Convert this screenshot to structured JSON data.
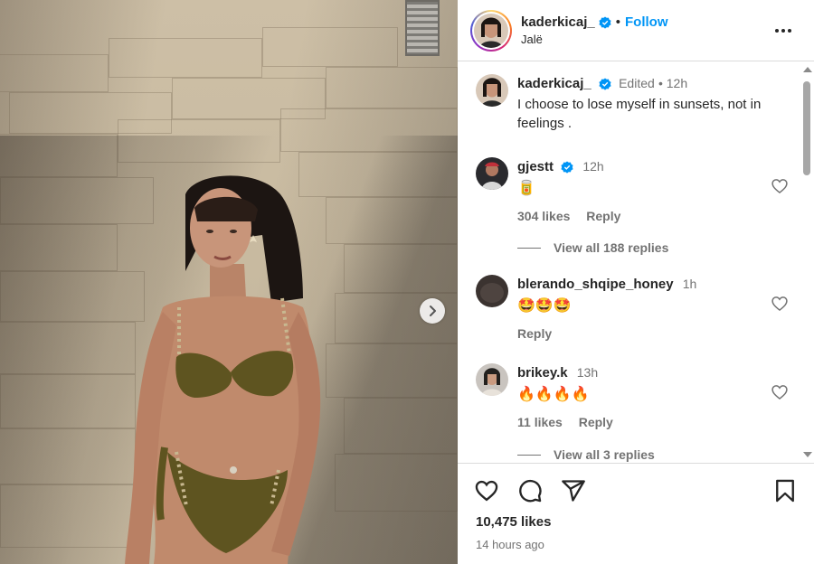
{
  "post": {
    "author": "kaderkicaj_",
    "follow_label": "Follow",
    "location": "Jalë",
    "likes": "10,475 likes",
    "time_ago": "14 hours ago"
  },
  "caption": {
    "username": "kaderkicaj_",
    "edited": "Edited",
    "time": "12h",
    "text": "I choose to lose myself in sunsets, not in feelings ."
  },
  "comments": [
    {
      "username": "gjestt",
      "verified": true,
      "time": "12h",
      "text": "🥫",
      "likes": "304 likes",
      "reply": "Reply",
      "view_replies": "View all 188 replies"
    },
    {
      "username": "blerando_shqipe_honey",
      "verified": false,
      "time": "1h",
      "text": "🤩🤩🤩",
      "likes": "",
      "reply": "Reply",
      "view_replies": ""
    },
    {
      "username": "brikey.k",
      "verified": false,
      "time": "13h",
      "text": "🔥🔥🔥🔥",
      "likes": "11 likes",
      "reply": "Reply",
      "view_replies": "View all 3 replies"
    }
  ],
  "colors": {
    "accent": "#0095f6",
    "text": "#262626",
    "secondary": "#737373",
    "divider": "#dbdbdb"
  },
  "icons": [
    "more-icon",
    "verified-icon",
    "heart-icon",
    "comment-icon",
    "share-icon",
    "bookmark-icon",
    "chevron-right-icon"
  ]
}
